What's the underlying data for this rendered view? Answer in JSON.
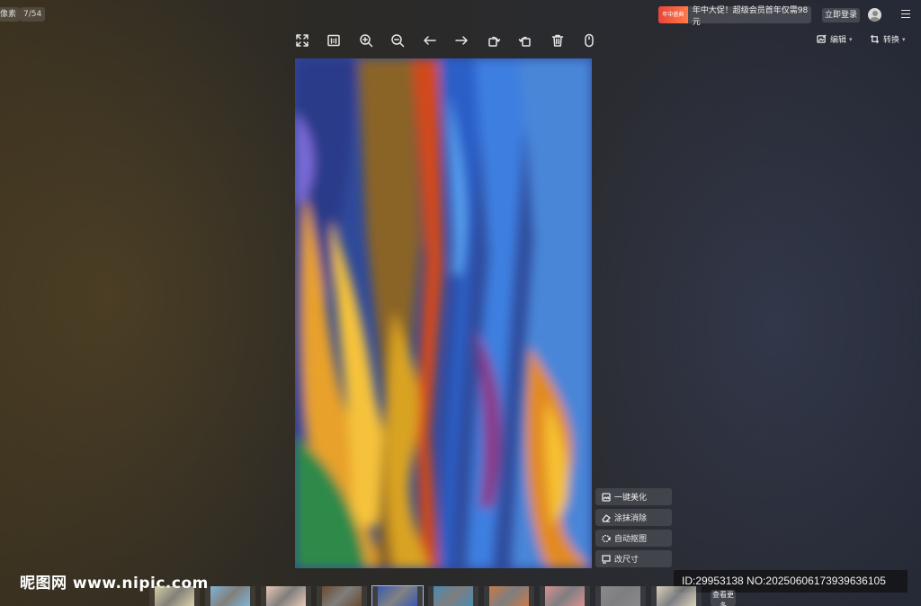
{
  "top_left": {
    "pixels_label": "像素",
    "counter": "7/54"
  },
  "toolbar": {
    "tools": [
      {
        "name": "fullscreen-icon"
      },
      {
        "name": "original-size-icon"
      },
      {
        "name": "zoom-in-icon"
      },
      {
        "name": "zoom-out-icon"
      },
      {
        "name": "previous-arrow-icon"
      },
      {
        "name": "next-arrow-icon"
      },
      {
        "name": "rotate-left-icon"
      },
      {
        "name": "rotate-right-icon"
      },
      {
        "name": "delete-icon"
      },
      {
        "name": "mouse-icon"
      }
    ]
  },
  "header": {
    "promo_tag": "年中盛典",
    "promo_text": "年中大促！超级会员首年仅需98元",
    "login_label": "立即登录",
    "edit_label": "编辑",
    "convert_label": "转换"
  },
  "side_actions": {
    "beautify": "一键美化",
    "erase": "涂抹消除",
    "cutout": "自动抠图",
    "resize": "改尺寸"
  },
  "watermark": "昵图网 www.nipic.com",
  "image_id": "ID:29953138 NO:20250606173939636105",
  "filmstrip": {
    "more_label": "查看更多",
    "selected_index": 4,
    "thumb_colors": [
      "#d8cfa6",
      "#7fb4d8",
      "#e8c8b8",
      "#6a4a30",
      "#3a5ab0",
      "#4a8ab0",
      "#c87a4a",
      "#d89090",
      "#8a8a8a",
      "#d8d0b8"
    ]
  },
  "colors": {
    "promo_red": "#e8453a",
    "selected_outline": "#9fb8ff"
  }
}
